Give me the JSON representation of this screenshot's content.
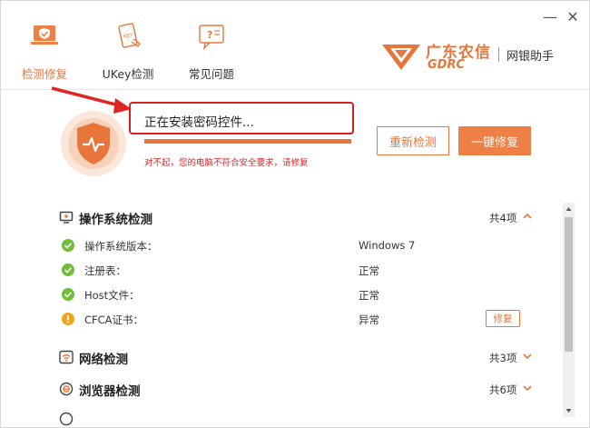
{
  "window": {
    "minimize": "—",
    "close": "✕"
  },
  "nav": [
    {
      "label": "检测修复",
      "icon": "laptop-shield-icon",
      "active": true
    },
    {
      "label": "UKey检测",
      "icon": "ukey-icon",
      "active": false
    },
    {
      "label": "常见问题",
      "icon": "chat-question-icon",
      "active": false
    }
  ],
  "logo": {
    "brand_cn": "广东农信",
    "brand_en": "GDRC",
    "product": "网银助手",
    "color": "#e8763a"
  },
  "status": {
    "message": "正在安装密码控件...",
    "progress": 1.0,
    "warning": "对不起，您的电脑不符合安全要求，请修复",
    "warning_color": "#e02525"
  },
  "actions": {
    "recheck": "重新检测",
    "repair": "一键修复"
  },
  "sections": [
    {
      "title": "操作系统检测",
      "icon": "monitor-icon",
      "count": "共4项",
      "expanded": true,
      "items": [
        {
          "label": "操作系统版本：",
          "value": "Windows 7",
          "status": "ok"
        },
        {
          "label": "注册表：",
          "value": "正常",
          "status": "ok"
        },
        {
          "label": "Host文件：",
          "value": "正常",
          "status": "ok"
        },
        {
          "label": "CFCA证书：",
          "value": "异常",
          "status": "warning",
          "action": "修复"
        }
      ]
    },
    {
      "title": "网络检测",
      "icon": "wifi-icon",
      "count": "共3项",
      "expanded": false
    },
    {
      "title": "浏览器检测",
      "icon": "browser-icon",
      "count": "共6项",
      "expanded": false
    }
  ],
  "colors": {
    "accent": "#e8763a",
    "ok": "#6fbe3c",
    "warn": "#f3a41b"
  }
}
